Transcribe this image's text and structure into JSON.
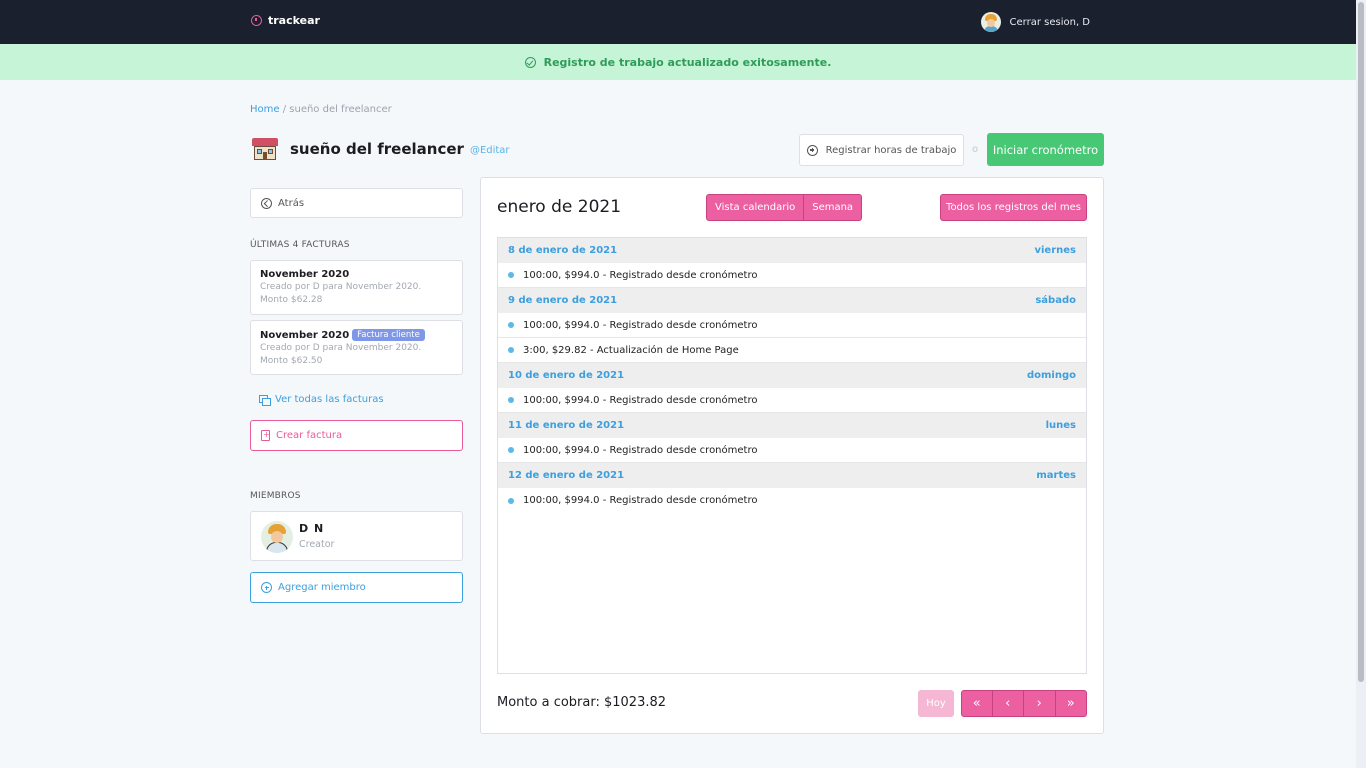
{
  "brand": {
    "name": "trackear"
  },
  "user": {
    "logout_label": "Cerrar sesion, D"
  },
  "alert": {
    "message": "Registro de trabajo actualizado exitosamente."
  },
  "breadcrumb": {
    "home": "Home",
    "separator": " / ",
    "current": "sueño del freelancer"
  },
  "project": {
    "title": "sueño del freelancer",
    "edit_label": "@Editar"
  },
  "actions": {
    "log_hours_label": "Registrar horas de trabajo",
    "or_label": "o",
    "start_timer_label": "Iniciar cronómetro"
  },
  "sidebar": {
    "back_label": "Atrás",
    "invoices_heading": "ÚLTIMAS 4 FACTURAS",
    "invoices": [
      {
        "title": "November 2020",
        "tag": "",
        "created": "Creado por D para November 2020.",
        "amount": "Monto $62.28"
      },
      {
        "title": "November 2020",
        "tag": "Factura cliente",
        "created": "Creado por D para November 2020.",
        "amount": "Monto $62.50"
      }
    ],
    "see_all_invoices": "Ver todas las facturas",
    "create_invoice": "Crear factura",
    "members_heading": "MIEMBROS",
    "members": [
      {
        "name": "D N",
        "role": "Creator"
      }
    ],
    "add_member": "Agregar miembro"
  },
  "calendar": {
    "month": "enero de 2021",
    "view_calendar": "Vista calendario",
    "view_week": "Semana",
    "all_records": "Todos los registros del mes",
    "days": [
      {
        "date": "8 de enero de 2021",
        "weekday": "viernes",
        "entries": [
          "100:00, $994.0 - Registrado desde cronómetro"
        ]
      },
      {
        "date": "9 de enero de 2021",
        "weekday": "sábado",
        "entries": [
          "100:00, $994.0 - Registrado desde cronómetro",
          "3:00, $29.82 - Actualización de Home Page"
        ]
      },
      {
        "date": "10 de enero de 2021",
        "weekday": "domingo",
        "entries": [
          "100:00, $994.0 - Registrado desde cronómetro"
        ]
      },
      {
        "date": "11 de enero de 2021",
        "weekday": "lunes",
        "entries": [
          "100:00, $994.0 - Registrado desde cronómetro"
        ]
      },
      {
        "date": "12 de enero de 2021",
        "weekday": "martes",
        "entries": [
          "100:00, $994.0 - Registrado desde cronómetro"
        ]
      }
    ],
    "total_label": "Monto a cobrar: $1023.82",
    "today_label": "Hoy",
    "pager": [
      "«",
      "‹",
      "›",
      "»"
    ]
  },
  "colors": {
    "accent": "#ec5fa0",
    "success": "#48c774",
    "link": "#3c9fde",
    "topbar": "#1b202e",
    "alert_bg": "#c6f4d6"
  }
}
